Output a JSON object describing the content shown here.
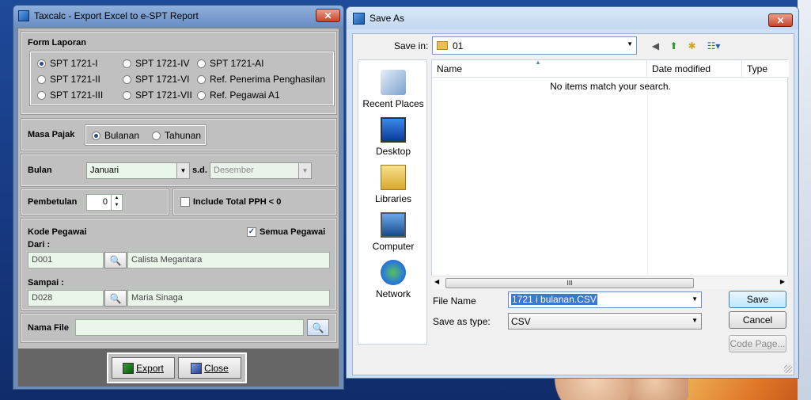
{
  "window1": {
    "title": "Taxcalc - Export Excel to e-SPT Report",
    "form_laporan": {
      "label": "Form Laporan",
      "options": [
        "SPT 1721-I",
        "SPT 1721-II",
        "SPT 1721-III",
        "SPT 1721-IV",
        "SPT 1721-VI",
        "SPT 1721-VII",
        "SPT 1721-AI",
        "Ref. Penerima Penghasilan",
        "Ref. Pegawai A1"
      ],
      "selected": "SPT 1721-I"
    },
    "masa_pajak": {
      "label": "Masa Pajak",
      "options": [
        "Bulanan",
        "Tahunan"
      ],
      "selected": "Bulanan"
    },
    "bulan": {
      "label": "Bulan",
      "from": "Januari",
      "sd_label": "s.d.",
      "to": "Desember"
    },
    "pembetulan": {
      "label": "Pembetulan",
      "value": "0"
    },
    "include_total": {
      "label": "Include Total PPH < 0",
      "checked": false
    },
    "kode_pegawai": {
      "label": "Kode Pegawai",
      "semua_label": "Semua Pegawai",
      "semua_checked": true,
      "dari_label": "Dari :",
      "dari_code": "D001",
      "dari_name": "Calista Megantara",
      "sampai_label": "Sampai :",
      "sampai_code": "D028",
      "sampai_name": "Maria Sinaga"
    },
    "nama_file": {
      "label": "Nama File",
      "value": ""
    },
    "buttons": {
      "export": "Export",
      "close": "Close"
    }
  },
  "window2": {
    "title": "Save As",
    "save_in_label": "Save in:",
    "save_in_value": "01",
    "places": [
      "Recent Places",
      "Desktop",
      "Libraries",
      "Computer",
      "Network"
    ],
    "columns": [
      "Name",
      "Date modified",
      "Type"
    ],
    "empty_message": "No items match your search.",
    "scroll_thumb": "III",
    "file_name_label": "File Name",
    "file_name_value": "1721 i bulanan.CSV",
    "save_type_label": "Save as type:",
    "save_type_value": "CSV",
    "buttons": {
      "save": "Save",
      "cancel": "Cancel",
      "code_page": "Code Page..."
    }
  }
}
